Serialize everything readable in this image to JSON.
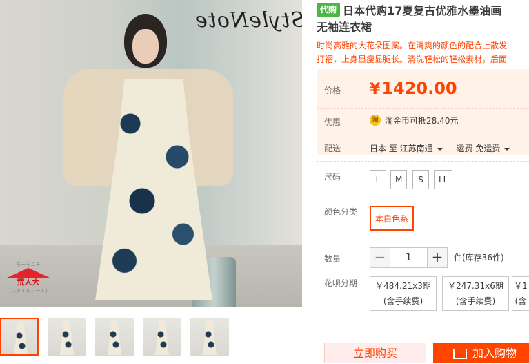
{
  "gallery": {
    "brand_text": "StyleNote",
    "badge": {
      "top": "ちーそニチ",
      "main": "荒人大",
      "sub": "[スタイルノート]"
    },
    "thumbnails": [
      "thumb-1",
      "thumb-2",
      "thumb-3",
      "thumb-4",
      "thumb-5"
    ],
    "active_thumbnail": 1
  },
  "product": {
    "tag": "代购",
    "title_line1": "日本代购17夏复古优雅水墨油画",
    "title_line2": "无袖连衣裙",
    "desc_line1": "时尚高雅的大花朵图案。在清爽的颜色的配合上散发",
    "desc_line2": "打褶，上身显瘦显腿长。清洗轻松的轻松素材，后面"
  },
  "price": {
    "label": "价格",
    "currency": "¥",
    "value": "1420.00",
    "promo_label": "优惠",
    "coin_icon": "淘",
    "promo_text": "淘金币可抵28.40元"
  },
  "shipping": {
    "label": "配送",
    "from": "日本 至",
    "to": "江苏南通",
    "fee": "运费 免运费"
  },
  "size": {
    "label": "尺码",
    "options": [
      "L",
      "M",
      "S",
      "LL"
    ]
  },
  "color": {
    "label": "颜色分类",
    "options": [
      "本白色系"
    ],
    "selected": "本白色系"
  },
  "quantity": {
    "label": "数量",
    "minus": "−",
    "value": "1",
    "plus": "+",
    "stock": "件(库存36件)"
  },
  "installment": {
    "label": "花呗分期",
    "options": [
      {
        "price": "￥484.21x3期",
        "fee": "(含手续费)"
      },
      {
        "price": "￥247.31x6期",
        "fee": "(含手续费)"
      },
      {
        "price": "￥1",
        "fee": "(含"
      }
    ]
  },
  "actions": {
    "buy_now": "立即购买",
    "add_cart": "加入购物"
  },
  "colors": {
    "accent": "#ff4400",
    "tag_green": "#4cb748",
    "price_bg": "#fff2e8"
  }
}
